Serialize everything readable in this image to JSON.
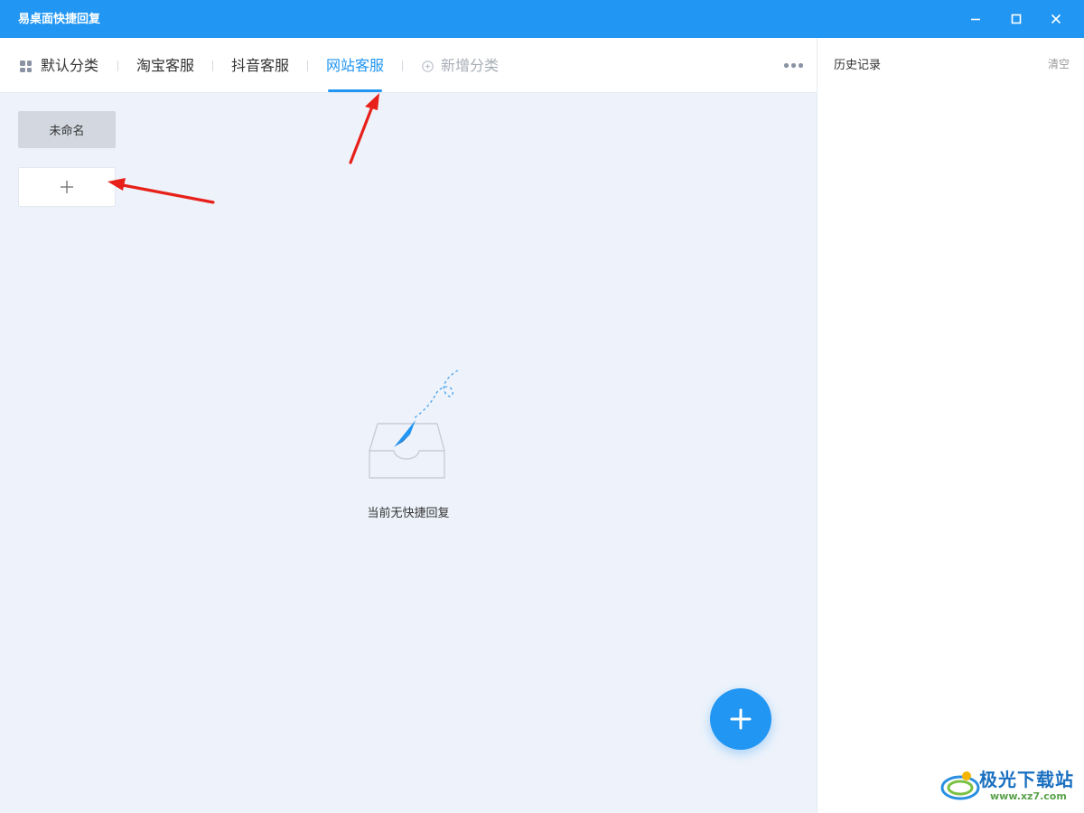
{
  "window": {
    "title": "易桌面快捷回复"
  },
  "tabs": [
    {
      "label": "默认分类",
      "active": false,
      "icon": "grid-icon"
    },
    {
      "label": "淘宝客服",
      "active": false
    },
    {
      "label": "抖音客服",
      "active": false
    },
    {
      "label": "网站客服",
      "active": true
    },
    {
      "label": "新增分类",
      "active": false,
      "icon": "add-circle-icon",
      "muted": true
    }
  ],
  "groups": [
    {
      "label": "未命名"
    }
  ],
  "empty_state": {
    "text": "当前无快捷回复",
    "icon": "inbox-paper-plane-icon"
  },
  "history": {
    "title": "历史记录",
    "clear_label": "清空"
  },
  "watermark": {
    "name": "极光下载站",
    "url": "www.xz7.com"
  },
  "colors": {
    "accent": "#2196f3",
    "panel_bg": "#eef3fb",
    "annotation_arrow": "#e8201a"
  }
}
